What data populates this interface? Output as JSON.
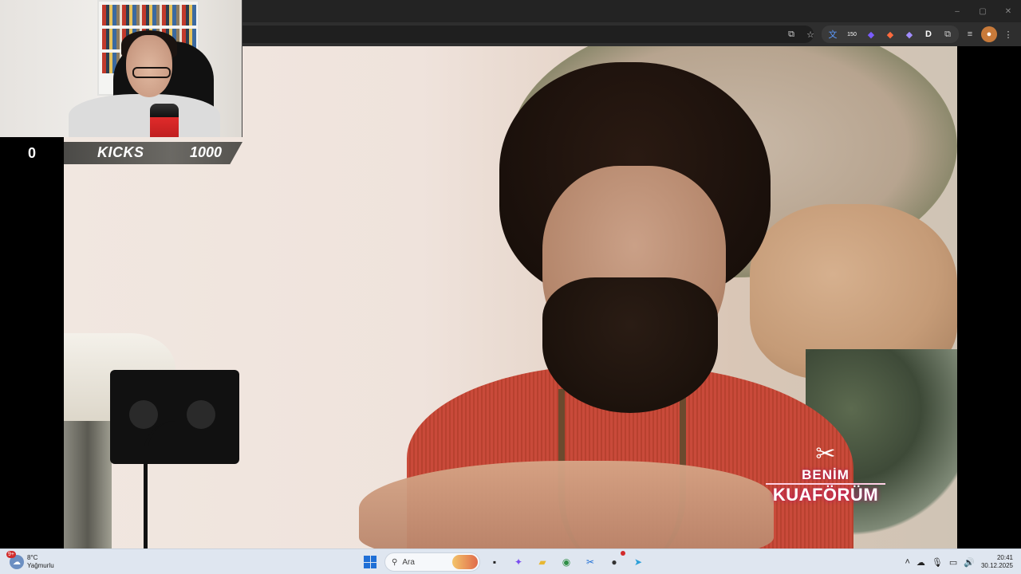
{
  "browser": {
    "window_controls": [
      "–",
      "▢",
      "✕"
    ],
    "toolbar_icons": [
      "cast-icon",
      "star-icon"
    ],
    "extensions": [
      {
        "name": "translate-extension-icon",
        "glyph": "文"
      },
      {
        "name": "counter-extension-icon",
        "glyph": "150"
      },
      {
        "name": "shield-extension-icon",
        "glyph": "◆"
      },
      {
        "name": "fox-extension-icon",
        "glyph": "◆"
      },
      {
        "name": "cloud-extension-icon",
        "glyph": "◆"
      },
      {
        "name": "d-extension-icon",
        "glyph": "D"
      },
      {
        "name": "puzzle-extension-icon",
        "glyph": "⧉"
      }
    ],
    "right_icons": [
      "media-icon",
      "profile-avatar",
      "menu-icon"
    ]
  },
  "stream_overlay": {
    "kicks_count": "0",
    "kicks_label": "KICKS",
    "kicks_goal": "1000"
  },
  "video": {
    "brand_line1": "BENİM",
    "brand_line2": "KUAFÖRÜM",
    "brand_icon": "✂"
  },
  "taskbar": {
    "weather": {
      "badge": "9+",
      "temperature": "8°C",
      "condition": "Yağmurlu"
    },
    "search_placeholder": "Ara",
    "apps": [
      {
        "name": "task-view-app",
        "glyph": "▪"
      },
      {
        "name": "copilot-app",
        "glyph": "✦"
      },
      {
        "name": "file-explorer-app",
        "glyph": "▰"
      },
      {
        "name": "chrome-app",
        "glyph": "◉"
      },
      {
        "name": "snipping-tool-app",
        "glyph": "✂"
      },
      {
        "name": "app-with-badge",
        "glyph": "●"
      },
      {
        "name": "telegram-app",
        "glyph": "➤"
      }
    ],
    "clock": {
      "time": "20:41",
      "date": "30.12.2025"
    }
  },
  "colors": {
    "kicks_strip": "#5e5c58",
    "brand_glow": "#c2136b",
    "taskbar": "#dfe6f0"
  }
}
